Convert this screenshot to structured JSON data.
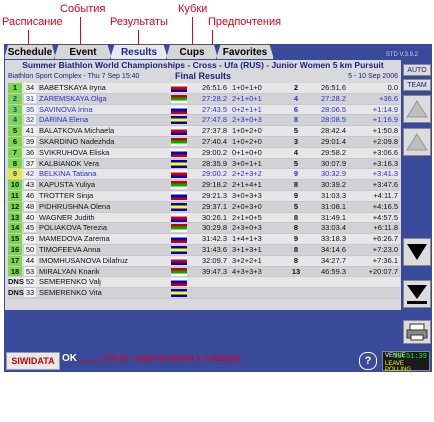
{
  "annotations": {
    "schedule": "Расписание",
    "events": "События",
    "results": "Результаты",
    "cups": "Кубки",
    "favorites": "Предпочтения",
    "connection": "статус подключения к серверу"
  },
  "tabs": [
    "Schedule",
    "Event",
    "Results",
    "Cups",
    "Favorites"
  ],
  "version": "STD V.3.9.2",
  "header": {
    "title": "Summer Biathlon World Championships - Cross - Ufa (RUS) - Junior Women 5 km Pursuit",
    "venue": "Biathlon Sport Complex - Thu 7 Sep 15:40",
    "subtitle": "Final Results",
    "dates": "5 - 10 Sep 2006"
  },
  "rows": [
    {
      "pos": "1",
      "bib": "34",
      "name": "BABETSKAYA Iryna",
      "t1": "26:51.6",
      "pen": "1+0+1+0",
      "rank": "2",
      "t2": "26:51.6",
      "diff": "0.0"
    },
    {
      "pos": "2",
      "bib": "31",
      "name": "ZAREMSKAYA Olga",
      "t1": "27:28.2",
      "pen": "2+1+0+1",
      "rank": "4",
      "t2": "27:28.2",
      "diff": "+36.6"
    },
    {
      "pos": "3",
      "bib": "35",
      "name": "SAVINOVA Irina",
      "t1": "27:43.5",
      "pen": "0+2+1+1",
      "rank": "6",
      "t2": "28:06.5",
      "diff": "+1:14.9"
    },
    {
      "pos": "4",
      "bib": "32",
      "name": "DARINA Elena",
      "t1": "27:47.8",
      "pen": "2+3+0+3",
      "rank": "8",
      "t2": "28:08.5",
      "diff": "+1:16.9"
    },
    {
      "pos": "5",
      "bib": "41",
      "name": "BALATKOVA Michaela",
      "t1": "27:37.8",
      "pen": "1+0+2+0",
      "rank": "5",
      "t2": "28:42.4",
      "diff": "+1:50.8"
    },
    {
      "pos": "6",
      "bib": "39",
      "name": "SKARDINO Nadezhda",
      "t1": "27:40.4",
      "pen": "1+0+2+0",
      "rank": "3",
      "t2": "29:01.4",
      "diff": "+2:09.8"
    },
    {
      "pos": "7",
      "bib": "36",
      "name": "SVIKRUHOVA Eliska",
      "t1": "29:00.2",
      "pen": "0+1+0+0",
      "rank": "4",
      "t2": "29:58.2",
      "diff": "+3:06.6"
    },
    {
      "pos": "8",
      "bib": "37",
      "name": "KALBIANOK Vera",
      "t1": "28:35.9",
      "pen": "3+0+1+1",
      "rank": "5",
      "t2": "30:07.9",
      "diff": "+3:16.3"
    },
    {
      "pos": "9",
      "bib": "42",
      "name": "BELKINA Tatiana",
      "t1": "29:00.2",
      "pen": "2+2+3+2",
      "rank": "9",
      "t2": "30:32.9",
      "diff": "+3:41.3"
    },
    {
      "pos": "10",
      "bib": "43",
      "name": "KAPUSTA Yuliya",
      "t1": "29:18.2",
      "pen": "2+1+4+1",
      "rank": "8",
      "t2": "30:39.2",
      "diff": "+3:47.6"
    },
    {
      "pos": "11",
      "bib": "46",
      "name": "TROTTER Sinja",
      "t1": "29:21.3",
      "pen": "3+0+3+3",
      "rank": "9",
      "t2": "31:03.3",
      "diff": "+4:11.7"
    },
    {
      "pos": "12",
      "bib": "48",
      "name": "PIDHRUSHNA Olena",
      "t1": "29:37.1",
      "pen": "2+0+3+0",
      "rank": "5",
      "t2": "31:08.1",
      "diff": "+4:16.5"
    },
    {
      "pos": "13",
      "bib": "40",
      "name": "WAGNER Judith",
      "t1": "30:26.1",
      "pen": "2+1+0+5",
      "rank": "8",
      "t2": "31:49.1",
      "diff": "+4:57.5"
    },
    {
      "pos": "14",
      "bib": "45",
      "name": "POLIAKOVA Terezia",
      "t1": "30:29.8",
      "pen": "2+3+0+3",
      "rank": "8",
      "t2": "33:03.4",
      "diff": "+6:11.8"
    },
    {
      "pos": "15",
      "bib": "49",
      "name": "MAMEDOVA Zarema",
      "t1": "31:42.3",
      "pen": "1+4+1+3",
      "rank": "9",
      "t2": "33:18.3",
      "diff": "+6:26.7"
    },
    {
      "pos": "16",
      "bib": "50",
      "name": "TIMOFEEVA Anna",
      "t1": "31:43.6",
      "pen": "3+1+3+1",
      "rank": "8",
      "t2": "34:14.6",
      "diff": "+7:23.0"
    },
    {
      "pos": "17",
      "bib": "44",
      "name": "IMOMHUSANOVA Dilafruz",
      "t1": "32:09.7",
      "pen": "3+2+2+1",
      "rank": "8",
      "t2": "34:27.7",
      "diff": "+7:36.1"
    },
    {
      "pos": "18",
      "bib": "53",
      "name": "MIRALYAN Knarik",
      "t1": "39:47.3",
      "pen": "4+3+3+3",
      "rank": "13",
      "t2": "46:59.3",
      "diff": "+20:07.7"
    },
    {
      "pos": "DNS",
      "bib": "52",
      "name": "SEMERENKO Valj",
      "t1": "",
      "pen": "",
      "rank": "",
      "t2": "",
      "diff": ""
    },
    {
      "pos": "DNS",
      "bib": "33",
      "name": "SEMERENKO Vita",
      "t1": "",
      "pen": "",
      "rank": "",
      "t2": "",
      "diff": ""
    }
  ],
  "side": {
    "auto": "AUTO",
    "team": "TEAM"
  },
  "status": {
    "brand": "SIWIDATA",
    "ok": "OK",
    "help": "?",
    "clock_label": "VENUE",
    "clock_time": "18:51:39",
    "clock_sub": "LEAVE POLLING"
  },
  "colors": {
    "accent": "#3a4a9a",
    "green": "#7bd84a",
    "yellow": "#e8e83a",
    "blue_text": "#2233dd"
  }
}
